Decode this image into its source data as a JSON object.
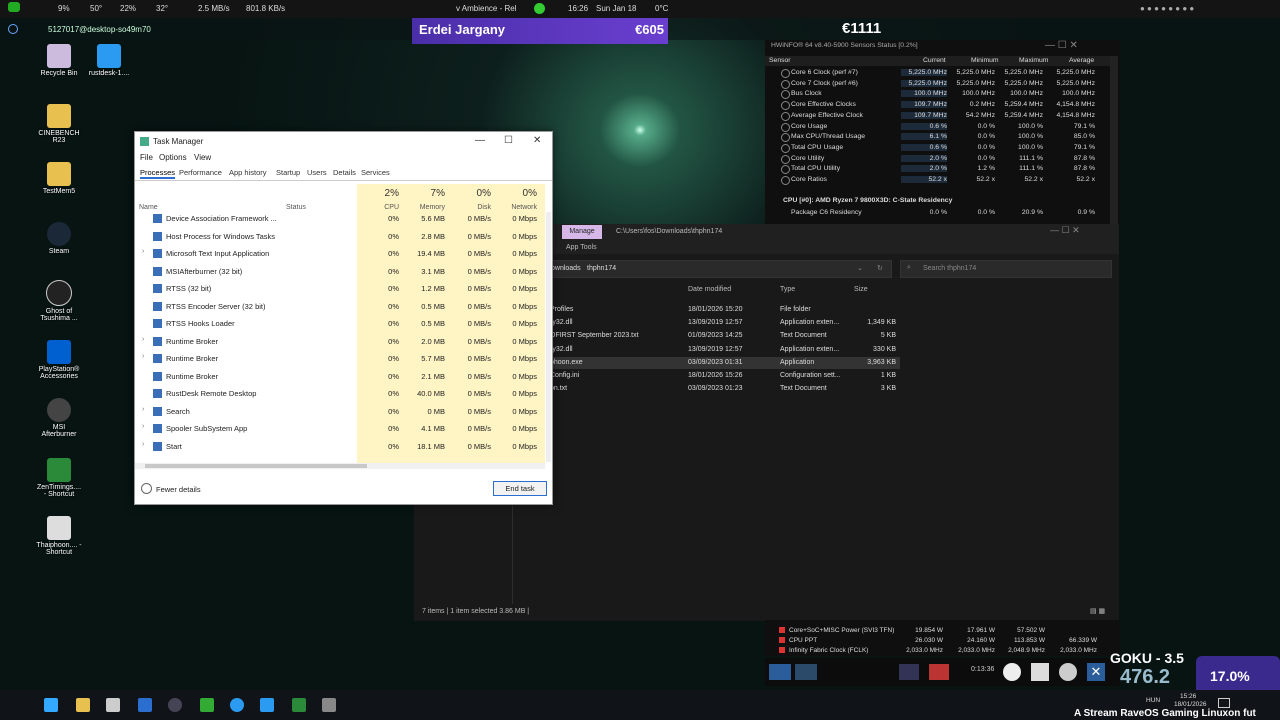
{
  "topbar": {
    "cpu": "9%",
    "temp1": "50°",
    "mem": "22%",
    "temp2": "32°",
    "net_down": "2.5 MB/s",
    "net_up": "801.8 KB/s",
    "music": "ᴠ Ambience - Rel",
    "time": "16:26",
    "date": "Sun Jan 18",
    "weather": "0°C"
  },
  "subbar": {
    "host": "5127017@desktop-so49m70"
  },
  "overlay": {
    "name": "Erdei Jargany",
    "amount": "€605",
    "amount2": "€1111"
  },
  "desktop_icons": [
    "Recycle Bin",
    "rustdesk-1....",
    "CINEBENCH R23",
    "TestMem5",
    "Steam",
    "Ghost of Tsushima ...",
    "PlayStation® Accessories",
    "MSI Afterburner",
    "ZenTimings.... - Shortcut",
    "Thaiphoon.... - Shortcut"
  ],
  "task_manager": {
    "title": "Task Manager",
    "menu": [
      "File",
      "Options",
      "View"
    ],
    "tabs": [
      "Processes",
      "Performance",
      "App history",
      "Startup",
      "Users",
      "Details",
      "Services"
    ],
    "columns": {
      "name": "Name",
      "status": "Status",
      "cpu": "CPU",
      "memory": "Memory",
      "disk": "Disk",
      "network": "Network"
    },
    "totals": {
      "cpu": "2%",
      "memory": "7%",
      "disk": "0%",
      "network": "0%"
    },
    "rows": [
      {
        "name": "Device Association Framework ...",
        "cpu": "0%",
        "mem": "5.6 MB",
        "disk": "0 MB/s",
        "net": "0 Mbps"
      },
      {
        "name": "Host Process for Windows Tasks",
        "cpu": "0%",
        "mem": "2.8 MB",
        "disk": "0 MB/s",
        "net": "0 Mbps"
      },
      {
        "name": "Microsoft Text Input Application",
        "cpu": "0%",
        "mem": "19.4 MB",
        "disk": "0 MB/s",
        "net": "0 Mbps"
      },
      {
        "name": "MSIAfterburner (32 bit)",
        "cpu": "0%",
        "mem": "3.1 MB",
        "disk": "0 MB/s",
        "net": "0 Mbps"
      },
      {
        "name": "RTSS (32 bit)",
        "cpu": "0%",
        "mem": "1.2 MB",
        "disk": "0 MB/s",
        "net": "0 Mbps"
      },
      {
        "name": "RTSS Encoder Server (32 bit)",
        "cpu": "0%",
        "mem": "0.5 MB",
        "disk": "0 MB/s",
        "net": "0 Mbps"
      },
      {
        "name": "RTSS Hooks Loader",
        "cpu": "0%",
        "mem": "0.5 MB",
        "disk": "0 MB/s",
        "net": "0 Mbps"
      },
      {
        "name": "Runtime Broker",
        "cpu": "0%",
        "mem": "2.0 MB",
        "disk": "0 MB/s",
        "net": "0 Mbps"
      },
      {
        "name": "Runtime Broker",
        "cpu": "0%",
        "mem": "5.7 MB",
        "disk": "0 MB/s",
        "net": "0 Mbps"
      },
      {
        "name": "Runtime Broker",
        "cpu": "0%",
        "mem": "2.1 MB",
        "disk": "0 MB/s",
        "net": "0 Mbps"
      },
      {
        "name": "RustDesk Remote Desktop",
        "cpu": "0%",
        "mem": "40.0 MB",
        "disk": "0 MB/s",
        "net": "0 Mbps"
      },
      {
        "name": "Search",
        "cpu": "0%",
        "mem": "0 MB",
        "disk": "0 MB/s",
        "net": "0 Mbps"
      },
      {
        "name": "Spooler SubSystem App",
        "cpu": "0%",
        "mem": "4.1 MB",
        "disk": "0 MB/s",
        "net": "0 Mbps"
      },
      {
        "name": "Start",
        "cpu": "0%",
        "mem": "18.1 MB",
        "disk": "0 MB/s",
        "net": "0 Mbps"
      }
    ],
    "fewer_details": "Fewer details",
    "end_task": "End task"
  },
  "explorer": {
    "manage": "Manage",
    "path_title": "C:\\Users\\fos\\Downloads\\thphn174",
    "app_tools": "App Tools",
    "crumb1": "ownloads",
    "crumb2": "thphn174",
    "search_placeholder": "Search thphn174",
    "columns": {
      "date": "Date modified",
      "type": "Type",
      "size": "Size"
    },
    "files": [
      {
        "name": "Profiles",
        "date": "18/01/2026 15:20",
        "type": "File folder",
        "size": ""
      },
      {
        "name": "ry32.dll",
        "date": "13/09/2019 12:57",
        "type": "Application exten...",
        "size": "1,349 KB"
      },
      {
        "name": "OFIRST September 2023.txt",
        "date": "01/09/2023 14:25",
        "type": "Text Document",
        "size": "5 KB"
      },
      {
        "name": "ry32.dll",
        "date": "13/09/2019 12:57",
        "type": "Application exten...",
        "size": "330 KB"
      },
      {
        "name": "phoon.exe",
        "date": "03/09/2023 01:31",
        "type": "Application",
        "size": "3,963 KB"
      },
      {
        "name": "Config.ini",
        "date": "18/01/2026 15:26",
        "type": "Configuration sett...",
        "size": "1 KB"
      },
      {
        "name": "on.txt",
        "date": "03/09/2023 01:23",
        "type": "Text Document",
        "size": "3 KB"
      }
    ],
    "status": "7 items  |  1 item selected  3.86 MB  |"
  },
  "hwinfo": {
    "title": "HWiNFO® 64 v8.40-5900 Sensors Status [0.2%]",
    "columns": [
      "Sensor",
      "Current",
      "Minimum",
      "Maximum",
      "Average"
    ],
    "rows": [
      [
        "Core 6 Clock (perf #7)",
        "5,225.0 MHz",
        "5,225.0 MHz",
        "5,225.0 MHz",
        "5,225.0 MHz"
      ],
      [
        "Core 7 Clock (perf #6)",
        "5,225.0 MHz",
        "5,225.0 MHz",
        "5,225.0 MHz",
        "5,225.0 MHz"
      ],
      [
        "Bus Clock",
        "100.0 MHz",
        "100.0 MHz",
        "100.0 MHz",
        "100.0 MHz"
      ],
      [
        "Core Effective Clocks",
        "109.7 MHz",
        "0.2 MHz",
        "5,259.4 MHz",
        "4,154.8 MHz"
      ],
      [
        "Average Effective Clock",
        "109.7 MHz",
        "54.2 MHz",
        "5,259.4 MHz",
        "4,154.8 MHz"
      ],
      [
        "Core Usage",
        "0.6 %",
        "0.0 %",
        "100.0 %",
        "79.1 %"
      ],
      [
        "Max CPU/Thread Usage",
        "6.1 %",
        "0.0 %",
        "100.0 %",
        "85.0 %"
      ],
      [
        "Total CPU Usage",
        "0.6 %",
        "0.0 %",
        "100.0 %",
        "79.1 %"
      ],
      [
        "Core Utility",
        "2.0 %",
        "0.0 %",
        "111.1 %",
        "87.8 %"
      ],
      [
        "Total CPU Utility",
        "2.0 %",
        "1.2 %",
        "111.1 %",
        "87.8 %"
      ],
      [
        "Core Ratios",
        "52.2 x",
        "52.2 x",
        "52.2 x",
        "52.2 x"
      ]
    ],
    "section": "CPU [#0]: AMD Ryzen 7 9800X3D: C-State Residency",
    "section_row": [
      "Package C6 Residency",
      "0.0 %",
      "0.0 %",
      "20.9 %",
      "0.9 %"
    ],
    "bottom_rows": [
      [
        "Core+SoC+MISC Power (SVI3 TFN)",
        "19.854 W",
        "17.961 W",
        "57.502 W"
      ],
      [
        "CPU PPT",
        "26.030 W",
        "24.160 W",
        "113.853 W",
        "66.339 W"
      ],
      [
        "Infinity Fabric Clock (FCLK)",
        "2,033.0 MHz",
        "2,033.0 MHz",
        "2,048.9 MHz",
        "2,033.0 MHz"
      ]
    ],
    "timer": "0:13:36"
  },
  "stream": {
    "goku": "GOKU - 3.5",
    "watts": "476.2",
    "percent": "17.0%",
    "ticker": "A Stream RaveOS Gaming Linuxon fut"
  },
  "taskbar": {
    "lang": "HUN",
    "time": "15:26",
    "date": "18/01/2026"
  }
}
